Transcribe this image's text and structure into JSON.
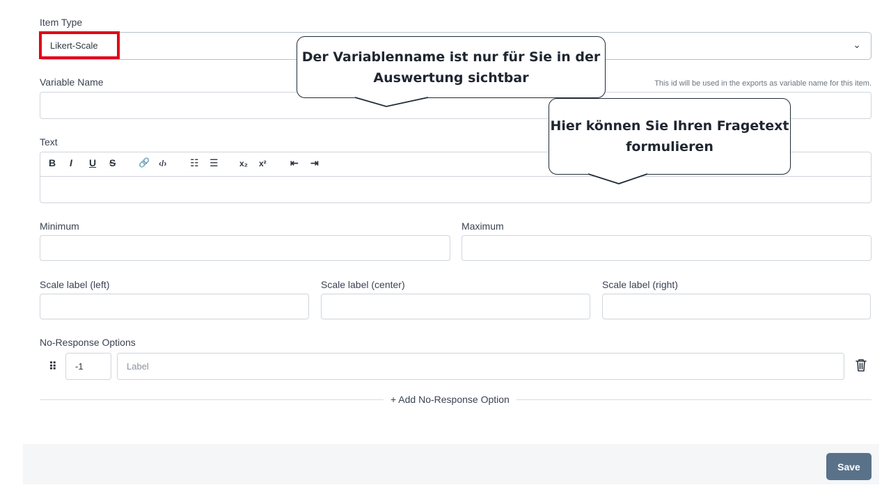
{
  "item_type": {
    "label": "Item Type",
    "value": "Likert-Scale"
  },
  "variable_name": {
    "label": "Variable Name",
    "hint": "This id will be used in the exports as variable name for this item.",
    "value": ""
  },
  "text": {
    "label": "Text",
    "toolbar": {
      "bold": "B",
      "italic": "I",
      "underline": "U",
      "strike": "S",
      "link": "🔗",
      "code": "‹/›",
      "ordered_list": "☷",
      "bullet_list": "☰",
      "subscript": "x₂",
      "superscript": "x²",
      "outdent": "⇤",
      "indent": "⇥"
    }
  },
  "minimum": {
    "label": "Minimum",
    "value": ""
  },
  "maximum": {
    "label": "Maximum",
    "value": ""
  },
  "scale_labels": {
    "left": {
      "label": "Scale label (left)",
      "value": ""
    },
    "center": {
      "label": "Scale label (center)",
      "value": ""
    },
    "right": {
      "label": "Scale label (right)",
      "value": ""
    }
  },
  "no_response": {
    "label": "No-Response Options",
    "options": [
      {
        "value": "-1",
        "label_placeholder": "Label"
      }
    ],
    "add_label": "+  Add No-Response Option"
  },
  "callouts": {
    "variable_name": "Der Variablenname ist nur für Sie in der Auswertung sichtbar",
    "question_text": "Hier können Sie Ihren Fragetext formulieren"
  },
  "footer": {
    "save_label": "Save"
  },
  "colors": {
    "highlight": "#e0001b",
    "save_button": "#5a7289"
  }
}
